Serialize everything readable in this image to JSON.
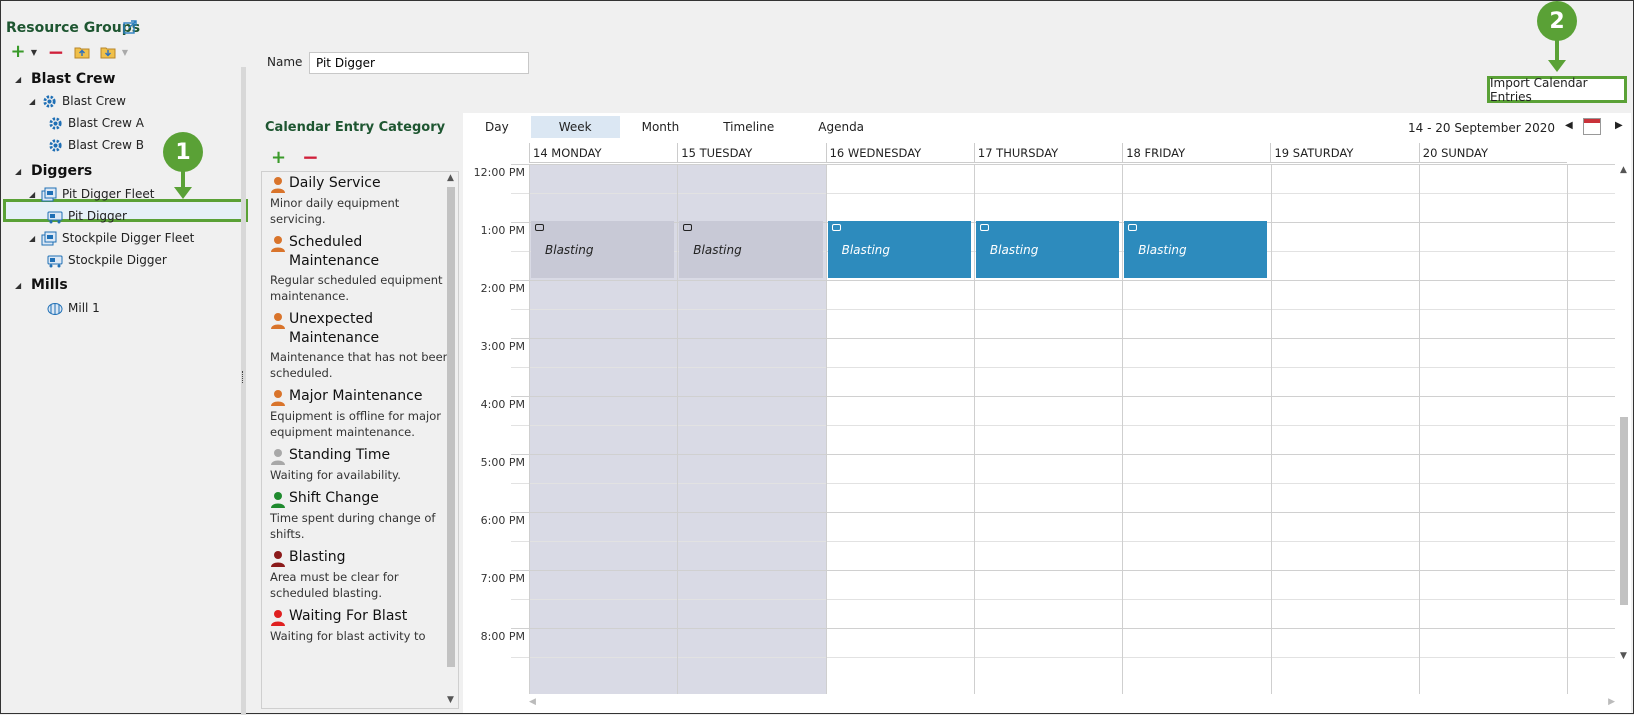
{
  "resource_groups": {
    "title": "Resource Groups",
    "tree": [
      {
        "label": "Blast Crew",
        "type": "group"
      },
      {
        "label": "Blast Crew",
        "type": "node-parent"
      },
      {
        "label": "Blast Crew A",
        "type": "node"
      },
      {
        "label": "Blast Crew B",
        "type": "node"
      },
      {
        "label": "Diggers",
        "type": "group"
      },
      {
        "label": "Pit Digger Fleet",
        "type": "node-parent"
      },
      {
        "label": "Pit Digger",
        "type": "node-selected"
      },
      {
        "label": "Stockpile Digger Fleet",
        "type": "node-parent"
      },
      {
        "label": "Stockpile Digger",
        "type": "node"
      },
      {
        "label": "Mills",
        "type": "group"
      },
      {
        "label": "Mill 1",
        "type": "node"
      }
    ]
  },
  "callouts": {
    "one": "1",
    "two": "2"
  },
  "name_field": {
    "label": "Name",
    "value": "Pit Digger"
  },
  "import_button": "Import Calendar Entries",
  "categories": {
    "title": "Calendar Entry Category",
    "items": [
      {
        "name": "Daily Service",
        "desc": "Minor daily equipment servicing.",
        "color": "#d9742b"
      },
      {
        "name": "Scheduled Maintenance",
        "desc": "Regular scheduled equipment maintenance.",
        "color": "#d9742b"
      },
      {
        "name": "Unexpected Maintenance",
        "desc": "Maintenance that has not been scheduled.",
        "color": "#d9742b"
      },
      {
        "name": "Major Maintenance",
        "desc": "Equipment is offline for major equipment maintenance.",
        "color": "#d9742b"
      },
      {
        "name": "Standing Time",
        "desc": "Waiting for availability.",
        "color": "#a8a8a8"
      },
      {
        "name": "Shift Change",
        "desc": "Time spent during change of shifts.",
        "color": "#1f8a2e"
      },
      {
        "name": "Blasting",
        "desc": "Area must be clear for scheduled blasting.",
        "color": "#8b1a1a"
      },
      {
        "name": "Waiting For Blast",
        "desc": "Waiting for blast activity to",
        "color": "#e02020"
      }
    ]
  },
  "calendar": {
    "views": [
      "Day",
      "Week",
      "Month",
      "Timeline",
      "Agenda"
    ],
    "active_view": "Week",
    "range": "14  - 20 September 2020",
    "days": [
      "14 MONDAY",
      "15 TUESDAY",
      "16 WEDNESDAY",
      "17 THURSDAY",
      "18 FRIDAY",
      "19 SATURDAY",
      "20 SUNDAY"
    ],
    "times": [
      "12:00 PM",
      "1:00 PM",
      "2:00 PM",
      "3:00 PM",
      "4:00 PM",
      "5:00 PM",
      "6:00 PM",
      "7:00 PM",
      "8:00 PM"
    ],
    "events": [
      {
        "day": 0,
        "title": "Blasting",
        "past": true
      },
      {
        "day": 1,
        "title": "Blasting",
        "past": true
      },
      {
        "day": 2,
        "title": "Blasting",
        "past": false
      },
      {
        "day": 3,
        "title": "Blasting",
        "past": false
      },
      {
        "day": 4,
        "title": "Blasting",
        "past": false
      }
    ]
  }
}
